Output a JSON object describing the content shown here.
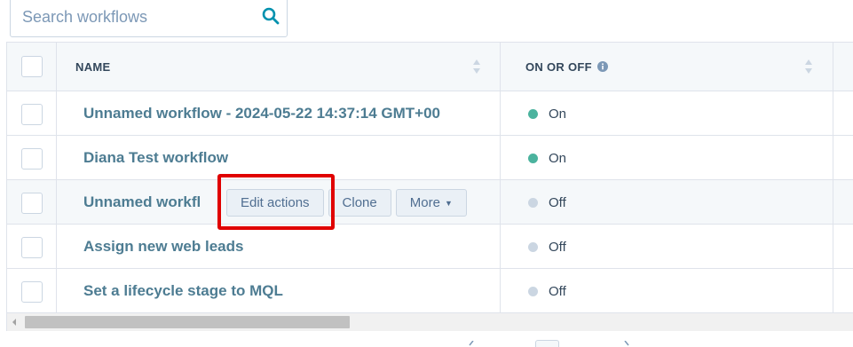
{
  "search": {
    "placeholder": "Search workflows"
  },
  "table": {
    "columns": {
      "name": "NAME",
      "status": "ON OR OFF"
    },
    "rows": [
      {
        "name": "Unnamed workflow - 2024-05-22 14:37:14 GMT+00",
        "status": "On"
      },
      {
        "name": "Diana Test workflow",
        "status": "On"
      },
      {
        "name": "Unnamed workfl",
        "status": "Off"
      },
      {
        "name": "Assign new web leads",
        "status": "Off"
      },
      {
        "name": "Set a lifecycle stage to MQL",
        "status": "Off"
      }
    ],
    "row_actions": {
      "edit": "Edit actions",
      "clone": "Clone",
      "more": "More"
    }
  },
  "colors": {
    "on": "#4bb39e",
    "off": "#cbd6e2",
    "link": "#4d7c92",
    "highlight": "#e00000"
  }
}
